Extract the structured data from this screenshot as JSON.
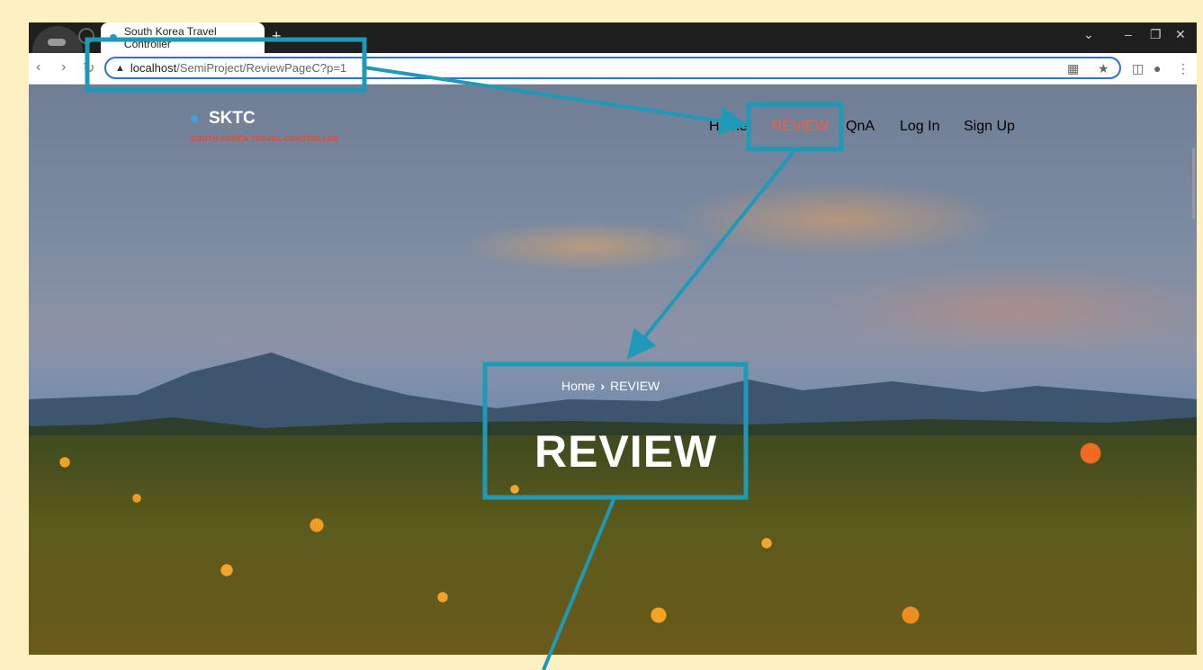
{
  "browser": {
    "tab_title": "South Korea Travel Controller",
    "new_tab_symbol": "+",
    "url_host": "localhost",
    "url_path": "/SemiProject/ReviewPageC?p=1",
    "icons": [
      "back-icon",
      "forward-icon",
      "reload-icon",
      "warning-icon",
      "qr-icon",
      "star-icon",
      "side-panel-icon",
      "profile-icon",
      "menu-icon",
      "minimize-icon",
      "restore-icon",
      "close-icon",
      "dropdown-icon"
    ]
  },
  "site": {
    "brand_name": "SKTC",
    "brand_subtitle": "SOUTH KOREA TRAVEL CONTROLLER",
    "nav": [
      {
        "label": "Home",
        "active": false
      },
      {
        "label": "REVIEW",
        "active": true
      },
      {
        "label": "QnA",
        "active": false
      },
      {
        "label": "Log In",
        "active": false
      },
      {
        "label": "Sign Up",
        "active": false
      }
    ],
    "breadcrumb_home": "Home",
    "breadcrumb_current": "REVIEW",
    "hero_title": "REVIEW"
  },
  "colors": {
    "page_bg": "#fdf0c2",
    "highlight_box": "#1e9ab8",
    "nav_active": "#ff5a36",
    "brand_subtitle": "#e54a2a"
  }
}
